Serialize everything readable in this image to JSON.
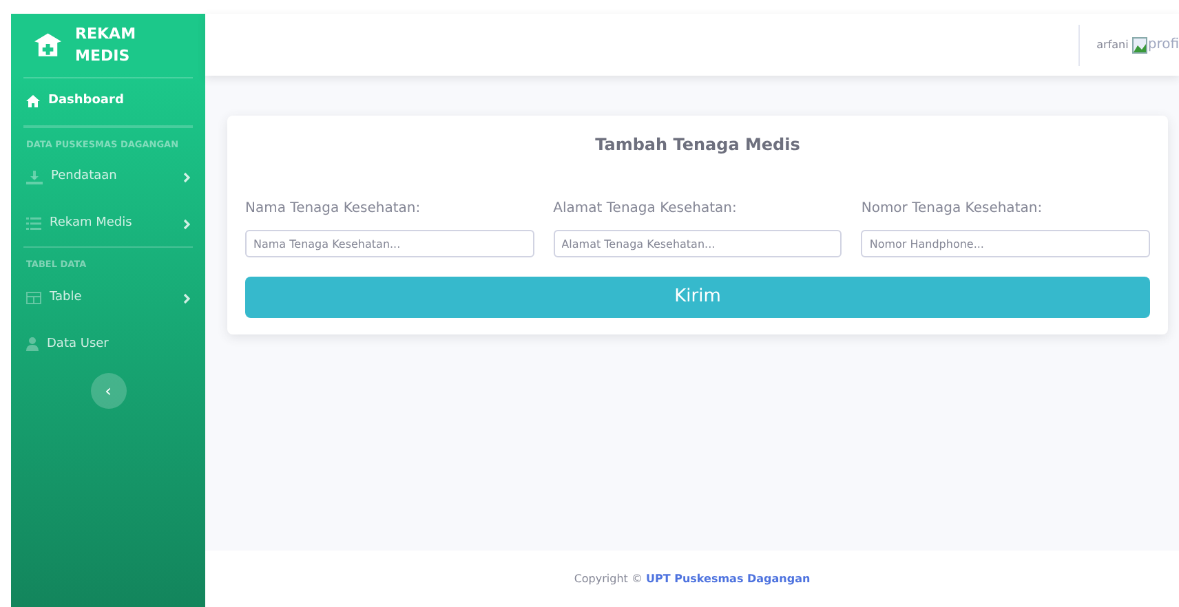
{
  "sidebar": {
    "brand": "REKAM MEDIS",
    "items": [
      {
        "kind": "link",
        "label": "Dashboard",
        "selected": true
      },
      {
        "kind": "heading",
        "label": "DATA PUSKESMAS DAGANGAN"
      },
      {
        "kind": "dropdown",
        "label": "Pendataan",
        "selected": false
      },
      {
        "kind": "dropdown",
        "label": "Rekam Medis",
        "selected": false
      },
      {
        "kind": "heading",
        "label": "TABEL DATA"
      },
      {
        "kind": "dropdown",
        "label": "Table",
        "selected": false
      },
      {
        "kind": "link",
        "label": "Data User",
        "selected": false
      }
    ],
    "toggle": "‹"
  },
  "topbar": {
    "user": "arfani",
    "avatar_alt": "profi"
  },
  "form": {
    "title": "Tambah Tenaga Medis",
    "fields": [
      {
        "label": "Nama Tenaga Kesehatan:",
        "placeholder": "Nama Tenaga Kesehatan..."
      },
      {
        "label": "Alamat Tenaga Kesehatan:",
        "placeholder": "Alamat Tenaga Kesehatan..."
      },
      {
        "label": "Nomor Tenaga Kesehatan:",
        "placeholder": "Nomor Handphone..."
      }
    ],
    "submit": "Kirim"
  },
  "footer": {
    "text": "Copyright ©",
    "link": "UPT Puskesmas Dagangan"
  }
}
